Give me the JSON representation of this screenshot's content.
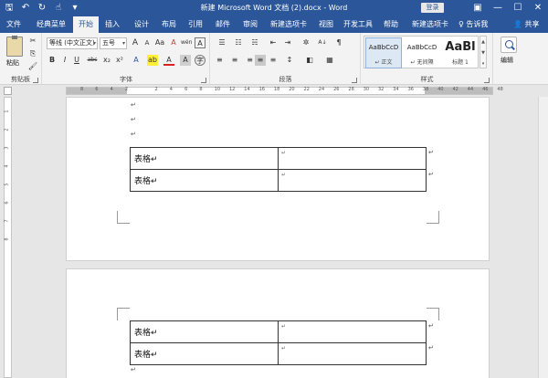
{
  "titlebar": {
    "title": "新建 Microsoft Word 文档 (2).docx  -  Word",
    "login": "登录",
    "qat": [
      "save-icon",
      "undo-icon",
      "redo-icon",
      "touch-icon",
      "customize-icon"
    ],
    "window": [
      "restore-ribbon-icon",
      "minimize-icon",
      "maximize-icon",
      "close-icon"
    ],
    "glyphs": {
      "save": "🖫",
      "undo": "↶",
      "redo": "↻",
      "touch": "☝",
      "customize": "▾",
      "ribbon_opt": "▣",
      "minimize": "—",
      "maximize": "☐",
      "close": "✕"
    }
  },
  "tabs": [
    {
      "label": "文件",
      "active": false
    },
    {
      "label": "经典菜单",
      "active": false
    },
    {
      "label": "开始",
      "active": true
    },
    {
      "label": "插入",
      "active": false
    },
    {
      "label": "设计",
      "active": false
    },
    {
      "label": "布局",
      "active": false
    },
    {
      "label": "引用",
      "active": false
    },
    {
      "label": "邮件",
      "active": false
    },
    {
      "label": "审阅",
      "active": false
    },
    {
      "label": "新建选项卡",
      "active": false
    },
    {
      "label": "视图",
      "active": false
    },
    {
      "label": "开发工具",
      "active": false
    },
    {
      "label": "帮助",
      "active": false
    },
    {
      "label": "新建选项卡",
      "active": false
    }
  ],
  "tellme": "♀ 告诉我",
  "share": "👤 共享",
  "ribbon": {
    "clipboard": {
      "label": "剪贴板",
      "paste": "粘贴",
      "cut": "✂",
      "copy": "⎘",
      "format_painter": "🖌"
    },
    "font": {
      "label": "字体",
      "font_name": "等线 (中文正文)",
      "font_size": "五号",
      "grow": "A",
      "shrink": "A",
      "change_case": "Aa",
      "clear_format": "A",
      "phonetic": "wén",
      "border": "A",
      "bold": "B",
      "italic": "I",
      "underline": "U",
      "strikethrough": "abc",
      "subscript": "x₂",
      "superscript": "x²",
      "text_effect": "A",
      "highlight": "ab",
      "font_color": "A",
      "char_shading": "A",
      "enclose": "字"
    },
    "paragraph": {
      "label": "段落",
      "bullets": "☰",
      "numbering": "☷",
      "multilevel": "☵",
      "dec_indent": "⇤",
      "inc_indent": "⇥",
      "chinese_layout": "✲",
      "sort": "A↓",
      "show_marks": "¶",
      "align_left": "≡",
      "center": "≡",
      "align_right": "≡",
      "justify": "≡",
      "distribute": "≡",
      "line_spacing": "↕",
      "shading": "◧",
      "borders": "▦"
    },
    "styles": {
      "label": "样式",
      "items": [
        {
          "preview": "AaBbCcD",
          "name": "↵ 正文",
          "selected": true
        },
        {
          "preview": "AaBbCcD",
          "name": "↵ 无间隔",
          "selected": false
        },
        {
          "preview": "AaBl",
          "name": "标题 1",
          "selected": false
        }
      ],
      "scroll": [
        "▲",
        "▼",
        "▾"
      ]
    },
    "editing": {
      "label": "编辑"
    }
  },
  "ruler": {
    "labels": [
      "8",
      "6",
      "4",
      "2",
      "",
      "2",
      "4",
      "6",
      "8",
      "10",
      "12",
      "14",
      "16",
      "18",
      "20",
      "22",
      "24",
      "26",
      "28",
      "30",
      "32",
      "34",
      "36",
      "38",
      "40",
      "42",
      "44",
      "46",
      "48"
    ]
  },
  "vruler": {
    "labels": [
      "1",
      "2",
      "3",
      "4",
      "5",
      "6",
      "7",
      "8"
    ]
  },
  "document": {
    "page1": {
      "marks": [
        "↵",
        "↵",
        "↵"
      ],
      "rows": [
        [
          "表格↵",
          "↵"
        ],
        [
          "表格↵",
          "↵"
        ]
      ],
      "row_end": [
        "↵",
        "↵"
      ]
    },
    "page2": {
      "rows": [
        [
          "表格↵",
          "↵"
        ],
        [
          "表格↵",
          "↵"
        ]
      ],
      "row_end": [
        "↵",
        "↵"
      ],
      "after": "↵"
    }
  }
}
